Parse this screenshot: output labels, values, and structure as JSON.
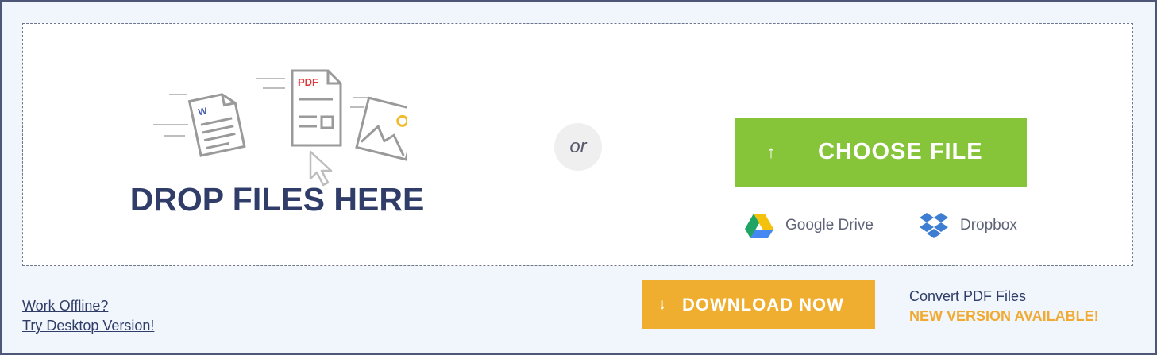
{
  "dropzone": {
    "title": "DROP FILES HERE",
    "or_label": "or",
    "illustration_icons": [
      "word-document-icon",
      "pdf-document-icon",
      "image-file-icon",
      "cursor-arrow-icon"
    ],
    "word_badge": "W",
    "pdf_badge": "PDF"
  },
  "upload": {
    "choose_label": "CHOOSE FILE",
    "choose_icon": "up-arrow-icon",
    "google_drive_label": "Google Drive",
    "dropbox_label": "Dropbox"
  },
  "footer": {
    "offline_link": "Work Offline?",
    "desktop_link": "Try Desktop Version!",
    "download_label": "DOWNLOAD NOW",
    "download_icon": "down-arrow-icon",
    "promo_line1": "Convert PDF Files",
    "promo_line2": "NEW VERSION AVAILABLE!"
  },
  "colors": {
    "frame_border": "#4e5778",
    "choose_green": "#86c53a",
    "download_orange": "#efae2f",
    "title_navy": "#2f3d68",
    "promo_orange": "#f0aa33"
  }
}
